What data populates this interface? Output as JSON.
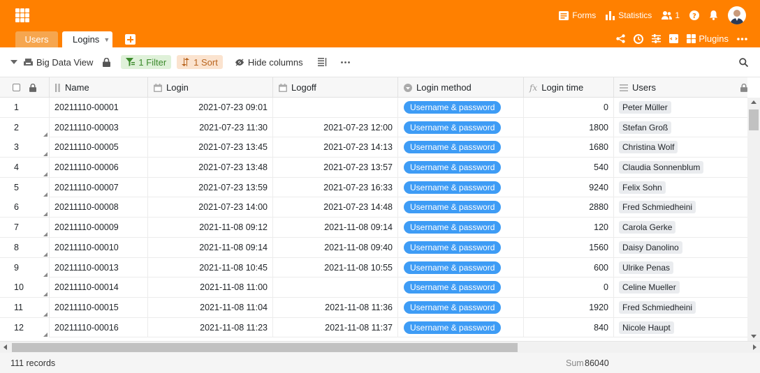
{
  "header": {
    "actions": {
      "forms": "Forms",
      "statistics": "Statistics",
      "collaborators_count": "1"
    },
    "tabs": [
      {
        "label": "Users"
      },
      {
        "label": "Logins"
      }
    ],
    "table_tools": {
      "plugins": "Plugins"
    }
  },
  "toolbar": {
    "view_name": "Big Data View",
    "filter": "1 Filter",
    "sort": "1 Sort",
    "hide_columns": "Hide columns"
  },
  "columns": [
    {
      "label": "Name",
      "icon": "primary-key-icon"
    },
    {
      "label": "Login",
      "icon": "calendar-icon"
    },
    {
      "label": "Logoff",
      "icon": "calendar-icon"
    },
    {
      "label": "Login method",
      "icon": "single-select-icon"
    },
    {
      "label": "Login time",
      "icon": "formula-icon"
    },
    {
      "label": "Users",
      "icon": "link-icon"
    }
  ],
  "rows": [
    {
      "n": "1",
      "name": "20211110-00001",
      "login": "2021-07-23 09:01",
      "logoff": "",
      "method": "Username & password",
      "time": "0",
      "user": "Peter Müller"
    },
    {
      "n": "2",
      "name": "20211110-00003",
      "login": "2021-07-23 11:30",
      "logoff": "2021-07-23 12:00",
      "method": "Username & password",
      "time": "1800",
      "user": "Stefan Groß"
    },
    {
      "n": "3",
      "name": "20211110-00005",
      "login": "2021-07-23 13:45",
      "logoff": "2021-07-23 14:13",
      "method": "Username & password",
      "time": "1680",
      "user": "Christina Wolf"
    },
    {
      "n": "4",
      "name": "20211110-00006",
      "login": "2021-07-23 13:48",
      "logoff": "2021-07-23 13:57",
      "method": "Username & password",
      "time": "540",
      "user": "Claudia Sonnenblum"
    },
    {
      "n": "5",
      "name": "20211110-00007",
      "login": "2021-07-23 13:59",
      "logoff": "2021-07-23 16:33",
      "method": "Username & password",
      "time": "9240",
      "user": "Felix Sohn"
    },
    {
      "n": "6",
      "name": "20211110-00008",
      "login": "2021-07-23 14:00",
      "logoff": "2021-07-23 14:48",
      "method": "Username & password",
      "time": "2880",
      "user": "Fred Schmiedheini"
    },
    {
      "n": "7",
      "name": "20211110-00009",
      "login": "2021-11-08 09:12",
      "logoff": "2021-11-08 09:14",
      "method": "Username & password",
      "time": "120",
      "user": "Carola Gerke"
    },
    {
      "n": "8",
      "name": "20211110-00010",
      "login": "2021-11-08 09:14",
      "logoff": "2021-11-08 09:40",
      "method": "Username & password",
      "time": "1560",
      "user": "Daisy Danolino"
    },
    {
      "n": "9",
      "name": "20211110-00013",
      "login": "2021-11-08 10:45",
      "logoff": "2021-11-08 10:55",
      "method": "Username & password",
      "time": "600",
      "user": "Ulrike Penas"
    },
    {
      "n": "10",
      "name": "20211110-00014",
      "login": "2021-11-08 11:00",
      "logoff": "",
      "method": "Username & password",
      "time": "0",
      "user": "Celine Mueller"
    },
    {
      "n": "11",
      "name": "20211110-00015",
      "login": "2021-11-08 11:04",
      "logoff": "2021-11-08 11:36",
      "method": "Username & password",
      "time": "1920",
      "user": "Fred Schmiedheini"
    },
    {
      "n": "12",
      "name": "20211110-00016",
      "login": "2021-11-08 11:23",
      "logoff": "2021-11-08 11:37",
      "method": "Username & password",
      "time": "840",
      "user": "Nicole Haupt"
    }
  ],
  "footer": {
    "records": "111 records",
    "sum_label": "Sum",
    "sum_value": "86040"
  },
  "colors": {
    "brand": "#ff8000",
    "pill": "#3e9cf5"
  }
}
